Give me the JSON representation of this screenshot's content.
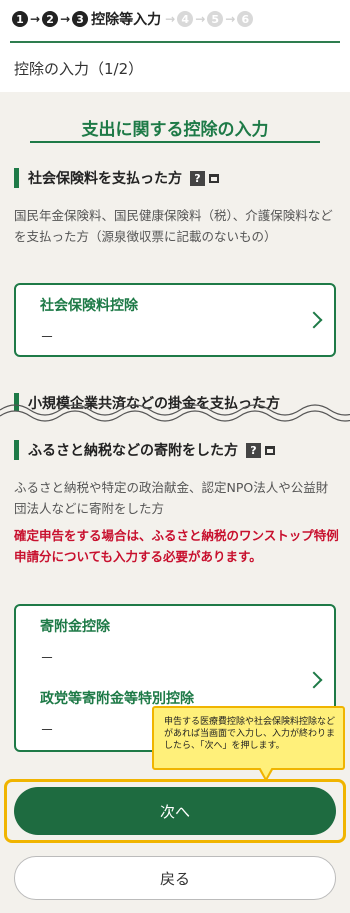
{
  "steps": {
    "items": [
      "1",
      "2",
      "3",
      "4",
      "5",
      "6"
    ],
    "current_label": "控除等入力",
    "current_index": 3
  },
  "page_title": "控除の入力（1/2）",
  "section_title": "支出に関する控除の入力",
  "social_insurance": {
    "heading": "社会保険料を支払った方",
    "description": "国民年金保険料、国民健康保険料（税）、介護保険料などを支払った方（源泉徴収票に記載のないもの）",
    "card_title": "社会保険料控除",
    "card_value": "－"
  },
  "small_business": {
    "heading": "小規模企業共済などの掛金を支払った方"
  },
  "donation": {
    "heading": "ふるさと納税などの寄附をした方",
    "description": "ふるさと納税や特定の政治献金、認定NPO法人や公益財団法人などに寄附をした方",
    "note": "確定申告をする場合は、ふるさと納税のワンストップ特例申請分についても入力する必要があります。",
    "card_title": "寄附金控除",
    "card_value": "－",
    "card_title2": "政党等寄附金等特別控除",
    "card_value2": "－"
  },
  "callout": {
    "text": "申告する医療費控除や社会保険料控除などがあれば当画面で入力し、入力が終わりましたら、「次へ」を押します。"
  },
  "buttons": {
    "next": "次へ",
    "back": "戻る"
  },
  "icons": {
    "help": "?",
    "help_icon": "help-icon",
    "window_icon": "new-window-icon",
    "chevron": "chevron-right-icon"
  },
  "colors": {
    "accent": "#1e7a47",
    "button": "#1e6b40",
    "warning": "#c8102e",
    "highlight": "#f0b400",
    "panel": "#f3f1ec"
  }
}
